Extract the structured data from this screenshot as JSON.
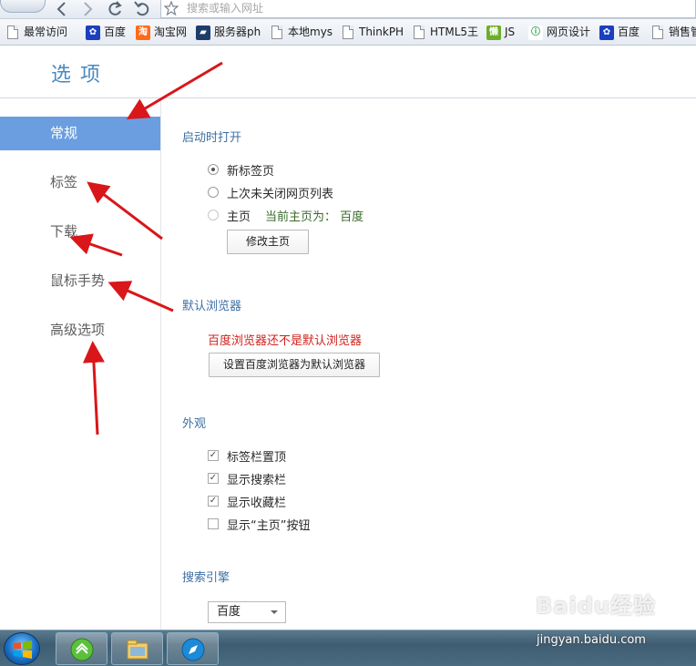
{
  "browser": {
    "address_placeholder": "搜索或输入网址"
  },
  "bookmarks": [
    {
      "label": "最常访问",
      "icon": "page-icon"
    },
    {
      "label": "百度",
      "icon": "paw-icon"
    },
    {
      "label": "淘宝网",
      "icon": "taobao-icon"
    },
    {
      "label": "服务器ph",
      "icon": "server-icon"
    },
    {
      "label": "本地mys",
      "icon": "page-icon"
    },
    {
      "label": "ThinkPH",
      "icon": "page-icon"
    },
    {
      "label": "HTML5王",
      "icon": "page-icon"
    },
    {
      "label": "JS",
      "icon": "lazy-icon"
    },
    {
      "label": "网页设计",
      "icon": "web-icon"
    },
    {
      "label": "百度",
      "icon": "paw-icon"
    },
    {
      "label": "销售管",
      "icon": "page-icon"
    }
  ],
  "page": {
    "title": "选项"
  },
  "sidebar": {
    "items": [
      {
        "label": "常规",
        "active": true
      },
      {
        "label": "标签",
        "active": false
      },
      {
        "label": "下载",
        "active": false
      },
      {
        "label": "鼠标手势",
        "active": false
      },
      {
        "label": "高级选项",
        "active": false
      }
    ]
  },
  "startup": {
    "title": "启动时打开",
    "options": [
      {
        "label": "新标签页",
        "checked": true
      },
      {
        "label": "上次未关闭网页列表",
        "checked": false
      },
      {
        "label": "主页",
        "checked": false
      }
    ],
    "home_note": "当前主页为： 百度",
    "modify_button": "修改主页"
  },
  "default_browser": {
    "title": "默认浏览器",
    "warning": "百度浏览器还不是默认浏览器",
    "set_button": "设置百度浏览器为默认浏览器"
  },
  "appearance": {
    "title": "外观",
    "options": [
      {
        "label": "标签栏置顶",
        "checked": true
      },
      {
        "label": "显示搜索栏",
        "checked": true
      },
      {
        "label": "显示收藏栏",
        "checked": true
      },
      {
        "label": "显示“主页”按钮",
        "checked": false
      }
    ]
  },
  "search_engine": {
    "title": "搜索引擎",
    "selected": "百度"
  },
  "watermark": {
    "brand": "Baidu经验",
    "url": "jingyan.baidu.com"
  },
  "colors": {
    "accent": "#6a9ee0",
    "title": "#4a8ac0",
    "section": "#3d6fa4",
    "warning": "#d0231e",
    "arrow": "#d9161a"
  }
}
